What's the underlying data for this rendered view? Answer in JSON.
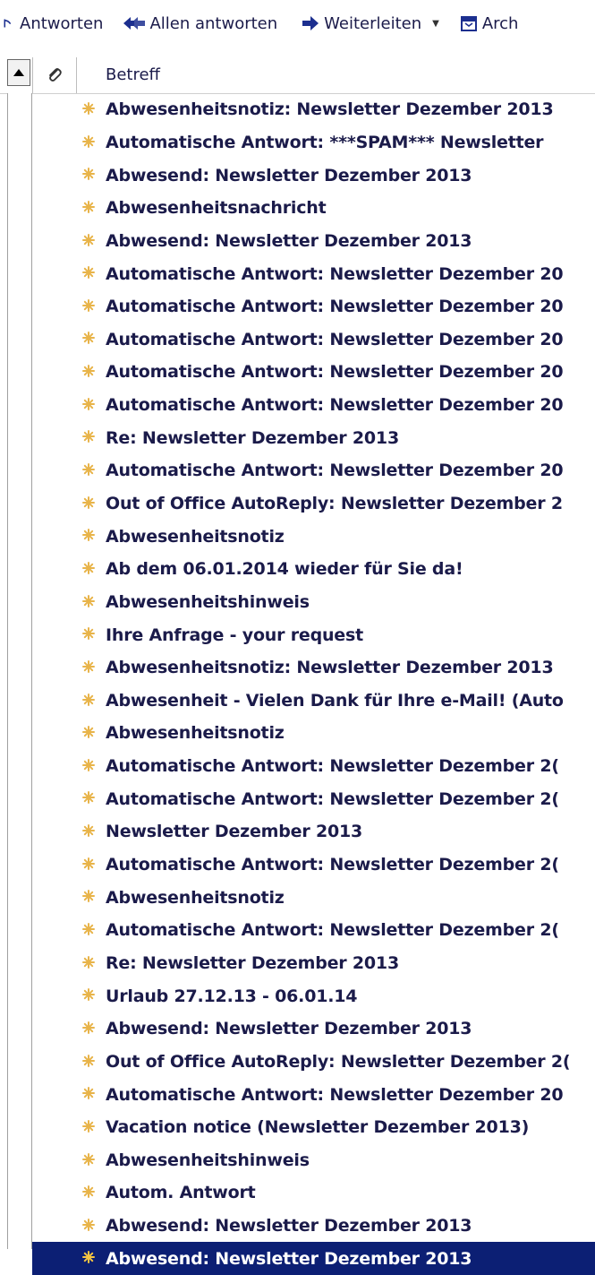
{
  "toolbar": {
    "reply_label": "Antworten",
    "reply_all_label": "Allen antworten",
    "forward_label": "Weiterleiten",
    "archive_label": "Arch"
  },
  "list_header": {
    "subject_label": "Betreff"
  },
  "messages": [
    {
      "subject": "Abwesenheitsnotiz: Newsletter Dezember 2013"
    },
    {
      "subject": "Automatische Antwort: ***SPAM*** Newsletter"
    },
    {
      "subject": "Abwesend: Newsletter Dezember 2013"
    },
    {
      "subject": "Abwesenheitsnachricht"
    },
    {
      "subject": "Abwesend: Newsletter Dezember 2013"
    },
    {
      "subject": "Automatische Antwort: Newsletter Dezember 20"
    },
    {
      "subject": "Automatische Antwort: Newsletter Dezember 20"
    },
    {
      "subject": "Automatische Antwort: Newsletter Dezember 20"
    },
    {
      "subject": "Automatische Antwort: Newsletter Dezember 20"
    },
    {
      "subject": "Automatische Antwort: Newsletter Dezember 20"
    },
    {
      "subject": "Re: Newsletter Dezember 2013"
    },
    {
      "subject": "Automatische Antwort: Newsletter Dezember 20"
    },
    {
      "subject": "Out of Office AutoReply: Newsletter Dezember 2"
    },
    {
      "subject": "Abwesenheitsnotiz"
    },
    {
      "subject": "Ab dem 06.01.2014 wieder für Sie da!"
    },
    {
      "subject": "Abwesenheitshinweis"
    },
    {
      "subject": "Ihre Anfrage - your request"
    },
    {
      "subject": "Abwesenheitsnotiz: Newsletter Dezember 2013"
    },
    {
      "subject": "Abwesenheit - Vielen Dank für Ihre e-Mail! (Auto"
    },
    {
      "subject": "Abwesenheitsnotiz"
    },
    {
      "subject": "Automatische Antwort: Newsletter Dezember 2("
    },
    {
      "subject": "Automatische Antwort: Newsletter Dezember 2("
    },
    {
      "subject": "Newsletter Dezember 2013"
    },
    {
      "subject": "Automatische Antwort: Newsletter Dezember 2("
    },
    {
      "subject": "Abwesenheitsnotiz"
    },
    {
      "subject": "Automatische Antwort: Newsletter Dezember 2("
    },
    {
      "subject": "Re: Newsletter Dezember 2013"
    },
    {
      "subject": "Urlaub 27.12.13 - 06.01.14"
    },
    {
      "subject": "Abwesend: Newsletter Dezember 2013"
    },
    {
      "subject": "Out of Office AutoReply: Newsletter Dezember 2("
    },
    {
      "subject": "Automatische Antwort: Newsletter Dezember 20"
    },
    {
      "subject": "Vacation notice (Newsletter Dezember 2013)"
    },
    {
      "subject": "Abwesenheitshinweis"
    },
    {
      "subject": "Autom. Antwort"
    },
    {
      "subject": "Abwesend: Newsletter Dezember 2013"
    },
    {
      "subject": "Abwesend: Newsletter Dezember 2013",
      "selected": true
    }
  ],
  "colors": {
    "text": "#1b1b4a",
    "star": "#e8b44a",
    "star_selected": "#f5c542",
    "selected_bg": "#0c1f74",
    "icon_blue": "#1c2f8f"
  },
  "icons": {
    "reply": "reply-arrow-icon",
    "reply_all": "reply-all-arrows-icon",
    "forward": "forward-arrow-icon",
    "dropdown": "dropdown-caret-icon",
    "archive": "archive-box-icon",
    "sort": "sort-up-triangle-icon",
    "attachment": "paperclip-icon",
    "star": "starred-flag-icon"
  }
}
